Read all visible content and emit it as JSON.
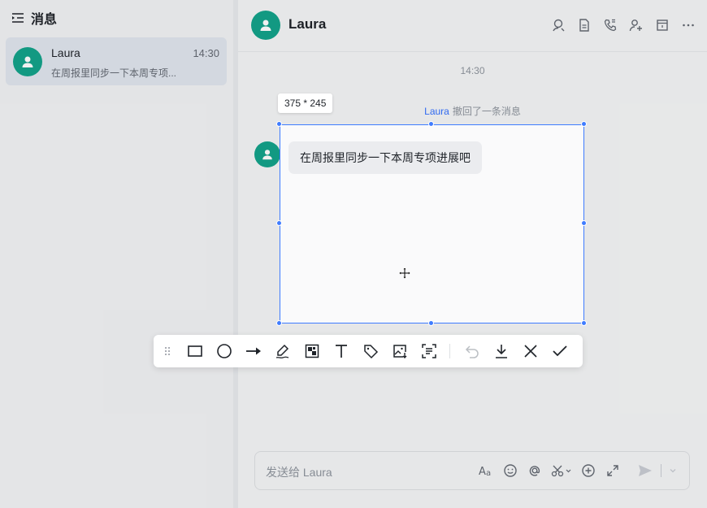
{
  "sidebar": {
    "title": "消息",
    "conversations": [
      {
        "name": "Laura",
        "time": "14:30",
        "preview": "在周报里同步一下本周专项..."
      }
    ]
  },
  "chat": {
    "title": "Laura",
    "header_icons": [
      "search-icon",
      "document-icon",
      "phone-icon",
      "add-member-icon",
      "calendar-icon",
      "more-icon"
    ],
    "timestamp": "14:30",
    "recall_user": "Laura",
    "recall_text": "撤回了一条消息",
    "input_placeholder": "发送给 Laura"
  },
  "screenshot": {
    "size_label": "375 * 245",
    "bubble_text": "在周报里同步一下本周专项进展吧",
    "toolbar": [
      "drag-handle-icon",
      "rectangle-icon",
      "circle-icon",
      "arrow-icon",
      "pen-icon",
      "mosaic-icon",
      "text-icon",
      "tag-icon",
      "image-icon",
      "ocr-icon",
      "undo-icon",
      "download-icon",
      "close-icon",
      "confirm-icon"
    ]
  },
  "colors": {
    "accent": "#3f7cff",
    "avatar": "#14a38b",
    "link": "#3370ff"
  }
}
